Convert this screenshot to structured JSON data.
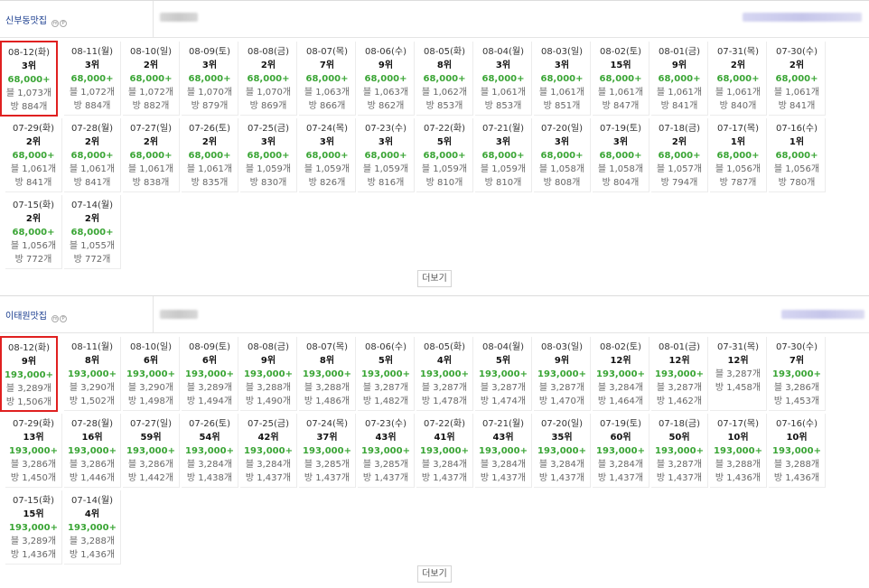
{
  "sections": [
    {
      "keyword": "신부동맛집",
      "more_label": "더보기",
      "rows": [
        {
          "date": "08-12(화)",
          "rank": "3위",
          "price": "68,000+",
          "blog": "블 1,073개",
          "room": "방 884개",
          "selected": true
        },
        {
          "date": "08-11(월)",
          "rank": "3위",
          "price": "68,000+",
          "blog": "블 1,072개",
          "room": "방 884개"
        },
        {
          "date": "08-10(일)",
          "rank": "2위",
          "price": "68,000+",
          "blog": "블 1,072개",
          "room": "방 882개"
        },
        {
          "date": "08-09(토)",
          "rank": "3위",
          "price": "68,000+",
          "blog": "블 1,070개",
          "room": "방 879개"
        },
        {
          "date": "08-08(금)",
          "rank": "2위",
          "price": "68,000+",
          "blog": "블 1,070개",
          "room": "방 869개"
        },
        {
          "date": "08-07(목)",
          "rank": "7위",
          "price": "68,000+",
          "blog": "블 1,063개",
          "room": "방 866개"
        },
        {
          "date": "08-06(수)",
          "rank": "9위",
          "price": "68,000+",
          "blog": "블 1,063개",
          "room": "방 862개"
        },
        {
          "date": "08-05(화)",
          "rank": "8위",
          "price": "68,000+",
          "blog": "블 1,062개",
          "room": "방 853개"
        },
        {
          "date": "08-04(월)",
          "rank": "3위",
          "price": "68,000+",
          "blog": "블 1,061개",
          "room": "방 853개"
        },
        {
          "date": "08-03(일)",
          "rank": "3위",
          "price": "68,000+",
          "blog": "블 1,061개",
          "room": "방 851개"
        },
        {
          "date": "08-02(토)",
          "rank": "15위",
          "price": "68,000+",
          "blog": "블 1,061개",
          "room": "방 847개"
        },
        {
          "date": "08-01(금)",
          "rank": "9위",
          "price": "68,000+",
          "blog": "블 1,061개",
          "room": "방 841개"
        },
        {
          "date": "07-31(목)",
          "rank": "2위",
          "price": "68,000+",
          "blog": "블 1,061개",
          "room": "방 840개"
        },
        {
          "date": "07-30(수)",
          "rank": "2위",
          "price": "68,000+",
          "blog": "블 1,061개",
          "room": "방 841개"
        },
        {
          "date": "07-29(화)",
          "rank": "2위",
          "price": "68,000+",
          "blog": "블 1,061개",
          "room": "방 841개"
        },
        {
          "date": "07-28(월)",
          "rank": "2위",
          "price": "68,000+",
          "blog": "블 1,061개",
          "room": "방 841개"
        },
        {
          "date": "07-27(일)",
          "rank": "2위",
          "price": "68,000+",
          "blog": "블 1,061개",
          "room": "방 838개"
        },
        {
          "date": "07-26(토)",
          "rank": "2위",
          "price": "68,000+",
          "blog": "블 1,061개",
          "room": "방 835개"
        },
        {
          "date": "07-25(금)",
          "rank": "3위",
          "price": "68,000+",
          "blog": "블 1,059개",
          "room": "방 830개"
        },
        {
          "date": "07-24(목)",
          "rank": "3위",
          "price": "68,000+",
          "blog": "블 1,059개",
          "room": "방 826개"
        },
        {
          "date": "07-23(수)",
          "rank": "3위",
          "price": "68,000+",
          "blog": "블 1,059개",
          "room": "방 816개"
        },
        {
          "date": "07-22(화)",
          "rank": "5위",
          "price": "68,000+",
          "blog": "블 1,059개",
          "room": "방 810개"
        },
        {
          "date": "07-21(월)",
          "rank": "3위",
          "price": "68,000+",
          "blog": "블 1,059개",
          "room": "방 810개"
        },
        {
          "date": "07-20(일)",
          "rank": "3위",
          "price": "68,000+",
          "blog": "블 1,058개",
          "room": "방 808개"
        },
        {
          "date": "07-19(토)",
          "rank": "3위",
          "price": "68,000+",
          "blog": "블 1,058개",
          "room": "방 804개"
        },
        {
          "date": "07-18(금)",
          "rank": "2위",
          "price": "68,000+",
          "blog": "블 1,057개",
          "room": "방 794개"
        },
        {
          "date": "07-17(목)",
          "rank": "1위",
          "price": "68,000+",
          "blog": "블 1,056개",
          "room": "방 787개"
        },
        {
          "date": "07-16(수)",
          "rank": "1위",
          "price": "68,000+",
          "blog": "블 1,056개",
          "room": "방 780개"
        },
        {
          "date": "07-15(화)",
          "rank": "2위",
          "price": "68,000+",
          "blog": "블 1,056개",
          "room": "방 772개"
        },
        {
          "date": "07-14(월)",
          "rank": "2위",
          "price": "68,000+",
          "blog": "블 1,055개",
          "room": "방 772개"
        }
      ]
    },
    {
      "keyword": "이태원맛집",
      "more_label": "더보기",
      "rows": [
        {
          "date": "08-12(화)",
          "rank": "9위",
          "price": "193,000+",
          "blog": "블 3,289개",
          "room": "방 1,506개",
          "selected": true
        },
        {
          "date": "08-11(월)",
          "rank": "8위",
          "price": "193,000+",
          "blog": "블 3,290개",
          "room": "방 1,502개"
        },
        {
          "date": "08-10(일)",
          "rank": "6위",
          "price": "193,000+",
          "blog": "블 3,290개",
          "room": "방 1,498개"
        },
        {
          "date": "08-09(토)",
          "rank": "6위",
          "price": "193,000+",
          "blog": "블 3,289개",
          "room": "방 1,494개"
        },
        {
          "date": "08-08(금)",
          "rank": "9위",
          "price": "193,000+",
          "blog": "블 3,288개",
          "room": "방 1,490개"
        },
        {
          "date": "08-07(목)",
          "rank": "8위",
          "price": "193,000+",
          "blog": "블 3,288개",
          "room": "방 1,486개"
        },
        {
          "date": "08-06(수)",
          "rank": "5위",
          "price": "193,000+",
          "blog": "블 3,287개",
          "room": "방 1,482개"
        },
        {
          "date": "08-05(화)",
          "rank": "4위",
          "price": "193,000+",
          "blog": "블 3,287개",
          "room": "방 1,478개"
        },
        {
          "date": "08-04(월)",
          "rank": "5위",
          "price": "193,000+",
          "blog": "블 3,287개",
          "room": "방 1,474개"
        },
        {
          "date": "08-03(일)",
          "rank": "9위",
          "price": "193,000+",
          "blog": "블 3,287개",
          "room": "방 1,470개"
        },
        {
          "date": "08-02(토)",
          "rank": "12위",
          "price": "193,000+",
          "blog": "블 3,284개",
          "room": "방 1,464개"
        },
        {
          "date": "08-01(금)",
          "rank": "12위",
          "price": "193,000+",
          "blog": "블 3,287개",
          "room": "방 1,462개"
        },
        {
          "date": "07-31(목)",
          "rank": "12위",
          "price": "",
          "blog": "블 3,287개",
          "room": "방 1,458개"
        },
        {
          "date": "07-30(수)",
          "rank": "7위",
          "price": "193,000+",
          "blog": "블 3,286개",
          "room": "방 1,453개"
        },
        {
          "date": "07-29(화)",
          "rank": "13위",
          "price": "193,000+",
          "blog": "블 3,286개",
          "room": "방 1,450개"
        },
        {
          "date": "07-28(월)",
          "rank": "16위",
          "price": "193,000+",
          "blog": "블 3,286개",
          "room": "방 1,446개"
        },
        {
          "date": "07-27(일)",
          "rank": "59위",
          "price": "193,000+",
          "blog": "블 3,286개",
          "room": "방 1,442개"
        },
        {
          "date": "07-26(토)",
          "rank": "54위",
          "price": "193,000+",
          "blog": "블 3,284개",
          "room": "방 1,438개"
        },
        {
          "date": "07-25(금)",
          "rank": "42위",
          "price": "193,000+",
          "blog": "블 3,284개",
          "room": "방 1,437개"
        },
        {
          "date": "07-24(목)",
          "rank": "37위",
          "price": "193,000+",
          "blog": "블 3,285개",
          "room": "방 1,437개"
        },
        {
          "date": "07-23(수)",
          "rank": "43위",
          "price": "193,000+",
          "blog": "블 3,285개",
          "room": "방 1,437개"
        },
        {
          "date": "07-22(화)",
          "rank": "41위",
          "price": "193,000+",
          "blog": "블 3,284개",
          "room": "방 1,437개"
        },
        {
          "date": "07-21(월)",
          "rank": "43위",
          "price": "193,000+",
          "blog": "블 3,284개",
          "room": "방 1,437개"
        },
        {
          "date": "07-20(일)",
          "rank": "35위",
          "price": "193,000+",
          "blog": "블 3,284개",
          "room": "방 1,437개"
        },
        {
          "date": "07-19(토)",
          "rank": "60위",
          "price": "193,000+",
          "blog": "블 3,284개",
          "room": "방 1,437개"
        },
        {
          "date": "07-18(금)",
          "rank": "50위",
          "price": "193,000+",
          "blog": "블 3,287개",
          "room": "방 1,437개"
        },
        {
          "date": "07-17(목)",
          "rank": "10위",
          "price": "193,000+",
          "blog": "블 3,288개",
          "room": "방 1,436개"
        },
        {
          "date": "07-16(수)",
          "rank": "10위",
          "price": "193,000+",
          "blog": "블 3,288개",
          "room": "방 1,436개"
        },
        {
          "date": "07-15(화)",
          "rank": "15위",
          "price": "193,000+",
          "blog": "블 3,289개",
          "room": "방 1,436개"
        },
        {
          "date": "07-14(월)",
          "rank": "4위",
          "price": "193,000+",
          "blog": "블 3,288개",
          "room": "방 1,436개"
        }
      ]
    }
  ],
  "colors": {
    "price": "#3aa535",
    "selected_border": "#e02020",
    "keyword": "#1a3d8f"
  }
}
